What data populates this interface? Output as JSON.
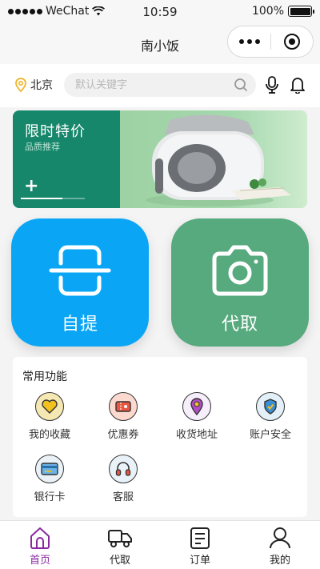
{
  "status_bar": {
    "carrier": "WeChat",
    "time": "10:59",
    "battery": "100%",
    "battery_level": 1.0
  },
  "nav": {
    "title": "南小饭"
  },
  "search_row": {
    "location": "北京",
    "search_placeholder": "默认关键字"
  },
  "banner": {
    "title": "限时特价",
    "subtitle": "品质推荐",
    "plus": "+",
    "progress": 0.65
  },
  "big_buttons": {
    "pickup_label": "自提",
    "fetch_label": "代取"
  },
  "functions": {
    "title": "常用功能",
    "items": [
      {
        "label": "我的收藏",
        "icon": "heart-icon"
      },
      {
        "label": "优惠券",
        "icon": "coupon-icon"
      },
      {
        "label": "收货地址",
        "icon": "location-pin-icon"
      },
      {
        "label": "账户安全",
        "icon": "shield-icon"
      },
      {
        "label": "银行卡",
        "icon": "bank-card-icon"
      },
      {
        "label": "客服",
        "icon": "headset-icon"
      }
    ]
  },
  "tab_bar": {
    "tabs": [
      {
        "label": "首页",
        "icon": "home-icon",
        "active": true
      },
      {
        "label": "代取",
        "icon": "delivery-truck-icon",
        "active": false
      },
      {
        "label": "订单",
        "icon": "order-list-icon",
        "active": false
      },
      {
        "label": "我的",
        "icon": "user-icon",
        "active": false
      }
    ]
  },
  "colors": {
    "pickup_blue": "#0aa6f5",
    "fetch_green": "#57a97e",
    "banner_green": "#17876b",
    "active_tab": "#8a2aa0"
  }
}
